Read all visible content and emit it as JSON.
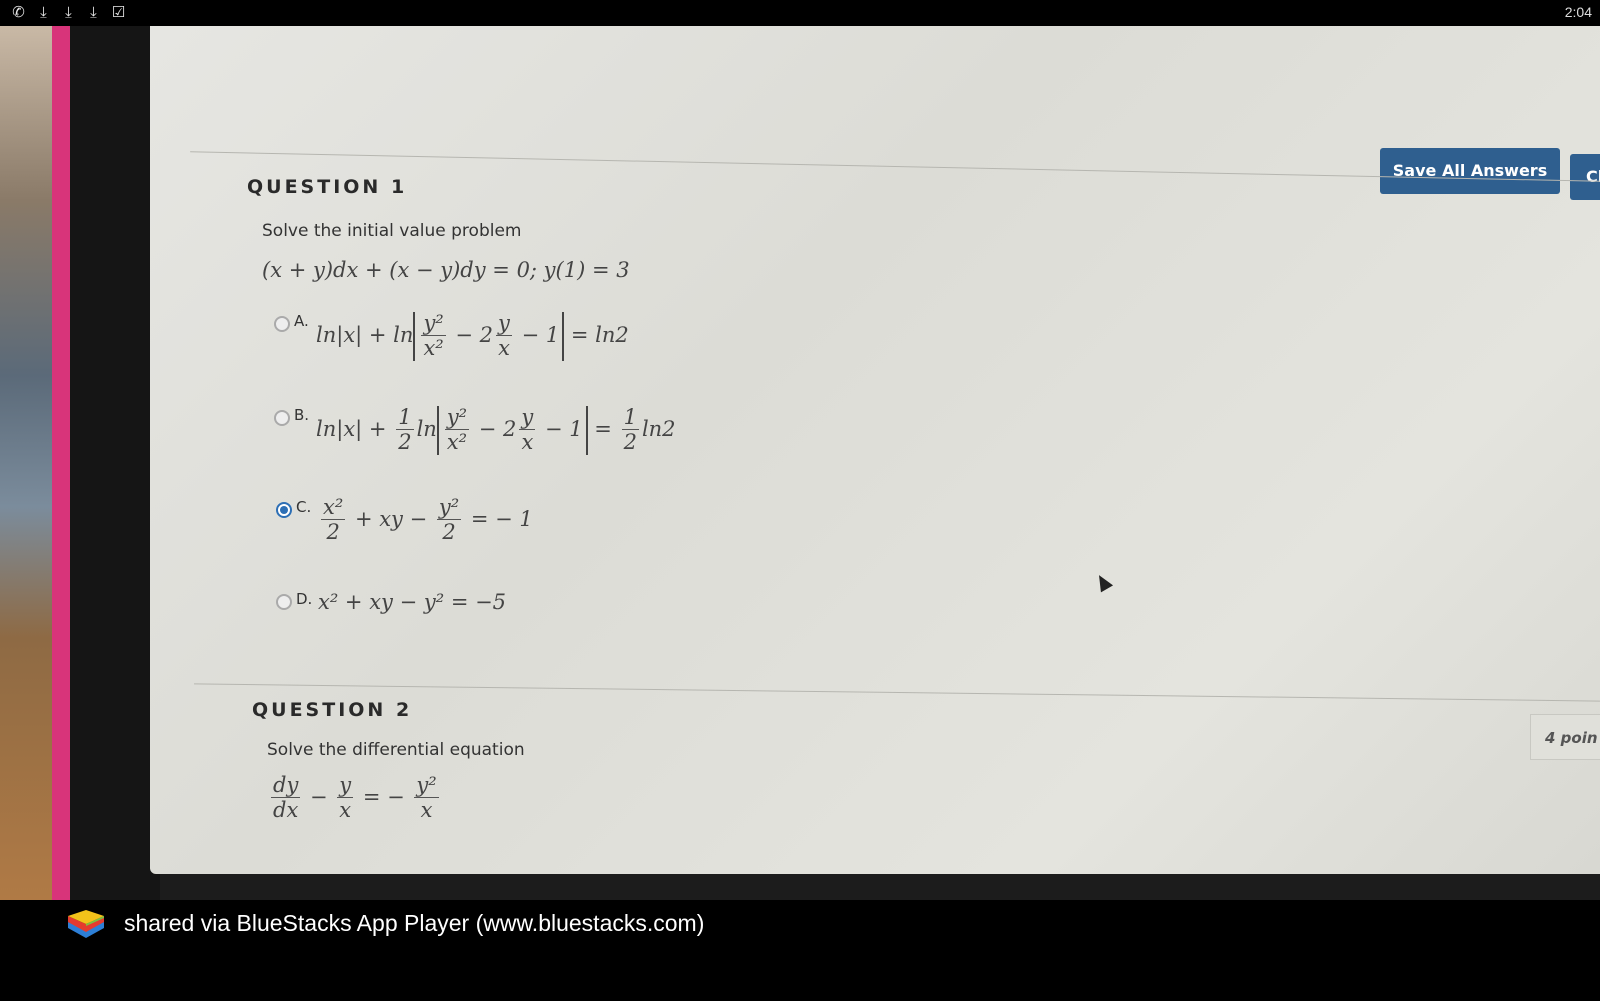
{
  "statusbar": {
    "icons": [
      "whatsapp-icon",
      "download-icon",
      "download-icon",
      "download-icon",
      "clipboard-check-icon"
    ],
    "time": "2:04"
  },
  "toolbar": {
    "save_all_label": "Save All Answers",
    "close_window_label": "Close Window"
  },
  "question1": {
    "title": "QUESTION 1",
    "prompt": "Solve the initial value problem",
    "equation": "(x + y)dx + (x − y)dy = 0; y(1) = 3",
    "options": [
      {
        "letter": "A.",
        "text": "ln|x| + ln| y²/x² − 2 y/x − 1 | = ln2",
        "selected": false
      },
      {
        "letter": "B.",
        "text": "ln|x| + 1/2 ln| y²/x² − 2 y/x − 1 | = 1/2 ln2",
        "selected": false
      },
      {
        "letter": "C.",
        "text": "x²/2 + xy − y²/2 = − 1",
        "selected": true
      },
      {
        "letter": "D.",
        "text": "x² + xy − y² = −5",
        "selected": false
      }
    ]
  },
  "question2": {
    "title": "QUESTION 2",
    "prompt": "Solve the differential equation",
    "equation": "dy/dx − y/x = − y²/x",
    "points": "4 poin"
  },
  "footer": {
    "share_text": "shared via BlueStacks App Player (www.bluestacks.com)"
  },
  "colors": {
    "button_blue": "#2f5f8f",
    "radio_selected": "#2d6fb5"
  }
}
